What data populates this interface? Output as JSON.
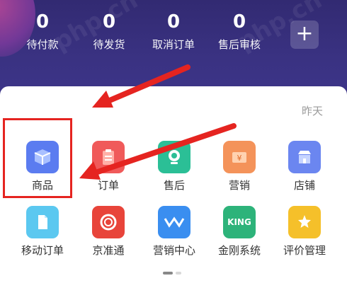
{
  "stats": [
    {
      "value": "0",
      "label": "待付款"
    },
    {
      "value": "0",
      "label": "待发货"
    },
    {
      "value": "0",
      "label": "取消订单"
    },
    {
      "value": "0",
      "label": "售后审核"
    }
  ],
  "add_button": "+",
  "date_label": "昨天",
  "apps": [
    {
      "label": "商品",
      "icon": "box-icon",
      "color": "#5b7cf0"
    },
    {
      "label": "订单",
      "icon": "clipboard-icon",
      "color": "#f05a5a"
    },
    {
      "label": "售后",
      "icon": "webcam-icon",
      "color": "#2bbf96"
    },
    {
      "label": "营销",
      "icon": "coupon-icon",
      "color": "#f4935a"
    },
    {
      "label": "店铺",
      "icon": "store-icon",
      "color": "#6b86f0"
    },
    {
      "label": "移动订单",
      "icon": "document-icon",
      "color": "#5bc8f0"
    },
    {
      "label": "京准通",
      "icon": "ring-logo-icon",
      "color": "#e8443a"
    },
    {
      "label": "营销中心",
      "icon": "wave-logo-icon",
      "color": "#3a8ef0"
    },
    {
      "label": "金刚系统",
      "icon": "king-logo-icon",
      "color": "#2db37a",
      "badge": "KING"
    },
    {
      "label": "评价管理",
      "icon": "star-chat-icon",
      "color": "#f5c02a"
    }
  ],
  "accent_color": "#e52420"
}
